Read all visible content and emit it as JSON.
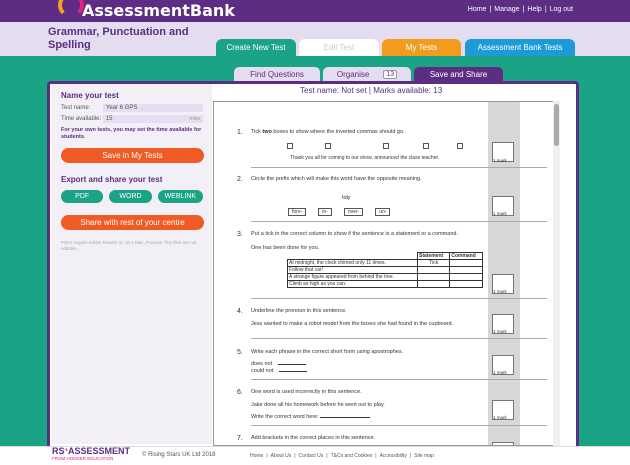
{
  "app": {
    "brand": "AssessmentBank"
  },
  "top_nav": {
    "home": "Home",
    "manage": "Manage",
    "help": "Help",
    "logout": "Log out",
    "sep": "|"
  },
  "header": {
    "title": "Grammar, Punctuation and Spelling"
  },
  "tabs": [
    {
      "label": "Create New Test"
    },
    {
      "label": "Edit Test"
    },
    {
      "label": "My Tests"
    },
    {
      "label": "Assessment Bank Tests"
    }
  ],
  "subtabs": {
    "find": "Find Questions",
    "organise": "Organise",
    "organise_count": "13",
    "save": "Save and Share"
  },
  "left": {
    "name_heading": "Name your test",
    "test_name_label": "Test name:",
    "test_name_value": "Year 6 GPS",
    "time_label": "Time available:",
    "time_value": "15",
    "time_unit": "mins",
    "own_tests_hint": "For your own tests, you may set the time available for students.",
    "save_button": "Save in My Tests",
    "export_heading": "Export and share your test",
    "pdf": "PDF",
    "word": "WORD",
    "weblink": "WEBLINK",
    "share_button": "Share with rest of your centre",
    "note": "PDFs require Adobe Reader or, on a Mac, Preview. The files are not editable."
  },
  "test_header": "Test name: Not set | Marks available: 13",
  "questions": {
    "mark_label": "1 mark",
    "q1": {
      "num": "1.",
      "text_a": "Tick ",
      "text_b": "two",
      "text_c": " boxes to show where the inverted commas should go.",
      "sentence": "Thank you all for coming to our show, announced the class teacher."
    },
    "q2": {
      "num": "2.",
      "text": "Circle the prefix which will make this word have the opposite meaning.",
      "word": "tidy",
      "options": [
        "fore-",
        "in-",
        "over-",
        "un-"
      ]
    },
    "q3": {
      "num": "3.",
      "text": "Put a tick in the correct column to show if the sentence is a statement or a command.",
      "sub": "One has been done for you.",
      "col1": "Statement",
      "col2": "Command",
      "rows": [
        {
          "s": "At midnight, the clock chimed only 11 times.",
          "a": "Tick",
          "b": ""
        },
        {
          "s": "Follow that car!",
          "a": "",
          "b": ""
        },
        {
          "s": "A strange figure appeared from behind the tree.",
          "a": "",
          "b": ""
        },
        {
          "s": "Climb as high as you can.",
          "a": "",
          "b": ""
        }
      ]
    },
    "q4": {
      "num": "4.",
      "text": "Underline the pronoun in this sentence.",
      "sentence": "Jess wanted to make a robot model from the boxes she had found in the cupboard."
    },
    "q5": {
      "num": "5.",
      "text": "Write each phrase in the correct short form using apostrophes.",
      "a": "does not",
      "b": "could not"
    },
    "q6": {
      "num": "6.",
      "text": "One word is used incorrectly in this sentence.",
      "sentence": "Jake done all his homework before he went out to play.",
      "prompt": "Write the correct word here:"
    },
    "q7": {
      "num": "7.",
      "text": "Add brackets in the correct places in this sentence."
    }
  },
  "footer": {
    "logo_a": "RS",
    "logo_sup": "+",
    "logo_b": "ASSESSMENT",
    "logo_sub": "FROM HODDER EDUCATION",
    "copyright": "© Rising Stars UK Ltd 2018",
    "links": [
      "Home",
      "About Us",
      "Contact Us",
      "T&Cs and Cookies",
      "Accessibility",
      "Site map"
    ],
    "sep": "|"
  },
  "colors": {
    "purple": "#5c2d82",
    "green": "#1ba386",
    "orange": "#f05a24",
    "yellow": "#f39b1f",
    "blue": "#1d9bd7"
  }
}
